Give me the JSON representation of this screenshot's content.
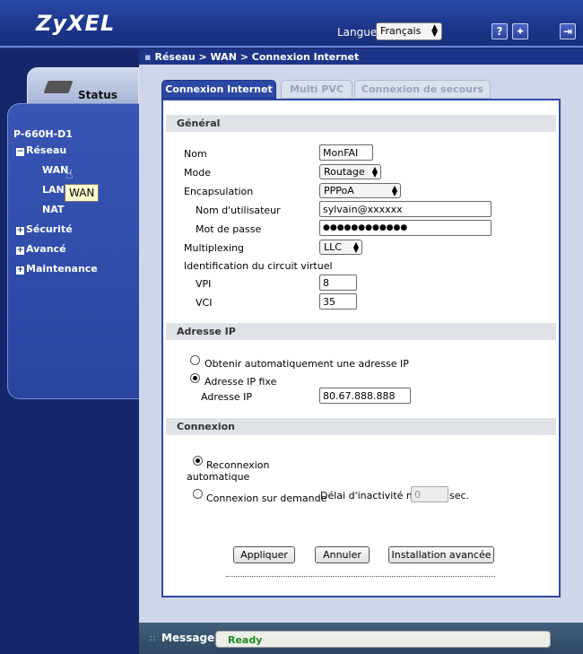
{
  "header": {
    "logo": "ZyXEL",
    "language_label": "Langue:",
    "language_value": "Français",
    "icons": [
      "help-icon",
      "wizard-icon",
      "logout-icon"
    ]
  },
  "sidebar": {
    "status_label": "Status",
    "device": "P-660H-D1",
    "tree": [
      {
        "label": "Réseau",
        "toggle": "−"
      },
      {
        "label": "WAN"
      },
      {
        "label": "LAN"
      },
      {
        "label": "NAT"
      },
      {
        "label": "Sécurité",
        "toggle": "+"
      },
      {
        "label": "Avancé",
        "toggle": "+"
      },
      {
        "label": "Maintenance",
        "toggle": "+"
      }
    ],
    "tooltip": "WAN"
  },
  "breadcrumb": "Réseau > WAN > Connexion Internet",
  "tabs": [
    "Connexion Internet",
    "Multi PVC",
    "Connexion de secours"
  ],
  "sections": {
    "general": "Général",
    "ip": "Adresse IP",
    "connexion": "Connexion"
  },
  "form": {
    "nom_label": "Nom",
    "nom_value": "MonFAI",
    "mode_label": "Mode",
    "mode_value": "Routage",
    "encap_label": "Encapsulation",
    "encap_value": "PPPoA",
    "user_label": "Nom d'utilisateur",
    "user_value": "sylvain@xxxxxx",
    "pass_label": "Mot de passe",
    "pass_value": "●●●●●●●●●●●●",
    "multiplex_label": "Multiplexing",
    "multiplex_value": "LLC",
    "vc_label": "Identification du circuit virtuel",
    "vpi_label": "VPI",
    "vpi_value": "8",
    "vci_label": "VCI",
    "vci_value": "35",
    "ip_auto_label": "Obtenir automatiquement une adresse IP",
    "ip_fixed_label": "Adresse IP fixe",
    "ip_addr_label": "Adresse IP",
    "ip_addr_value": "80.67.888.888",
    "reconnect_label_1": "Reconnexion",
    "reconnect_label_2": "automatique",
    "ondemand_label": "Connexion sur demande",
    "idle_label": "Délai d'inactivité max",
    "idle_value": "0",
    "idle_unit": "sec."
  },
  "buttons": {
    "apply": "Appliquer",
    "cancel": "Annuler",
    "advanced": "Installation avancée"
  },
  "message": {
    "label": "Message",
    "status": "Ready"
  }
}
